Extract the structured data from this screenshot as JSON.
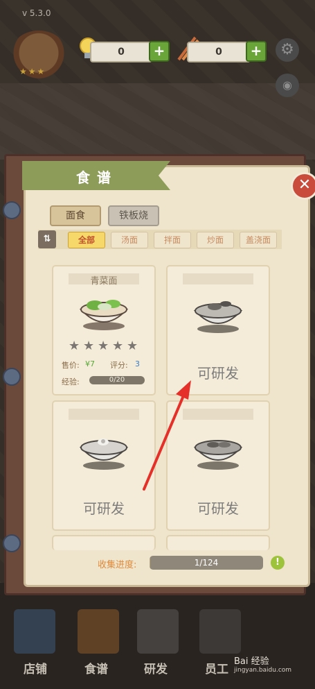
{
  "version": "v 5.3.0",
  "resources": [
    {
      "icon": "lightbulb-icon",
      "value": "0"
    },
    {
      "icon": "chopsticks-icon",
      "value": "0"
    }
  ],
  "add_symbol": "+",
  "recipe_book": {
    "title": "食谱",
    "close_symbol": "✕",
    "tabs": [
      {
        "label": "面食",
        "active": true
      },
      {
        "label": "铁板烧",
        "active": false
      }
    ],
    "sort_icon": "⇅",
    "filters": [
      {
        "label": "全部",
        "active": true
      },
      {
        "label": "汤面",
        "active": false
      },
      {
        "label": "拌面",
        "active": false
      },
      {
        "label": "炒面",
        "active": false
      },
      {
        "label": "盖浇面",
        "active": false
      }
    ],
    "cards": [
      {
        "name": "青菜面",
        "stars_rating": 0,
        "stars_total": 5,
        "price_label": "售价:",
        "price_value": "¥7",
        "rating_label": "评分:",
        "rating_value": "3",
        "exp_label": "经验:",
        "exp_value": "0/20",
        "exp_fraction": 0
      },
      {
        "research_label": "可研发"
      },
      {
        "research_label": "可研发"
      },
      {
        "research_label": "可研发"
      }
    ],
    "progress_label": "收集进度:",
    "progress_value": "1/124",
    "progress_fraction": 0.008,
    "hint_symbol": "!"
  },
  "bottom_nav": [
    {
      "label": "店铺"
    },
    {
      "label": "食谱"
    },
    {
      "label": "研发"
    },
    {
      "label": "员工"
    }
  ],
  "watermark": {
    "text": "Bai 经验",
    "sub": "jingyan.baidu.com"
  },
  "colors": {
    "accent_green": "#6aa53a",
    "close_red": "#c84b3c",
    "filter_active": "#f6d86a",
    "arrow_red": "#e5302a"
  }
}
